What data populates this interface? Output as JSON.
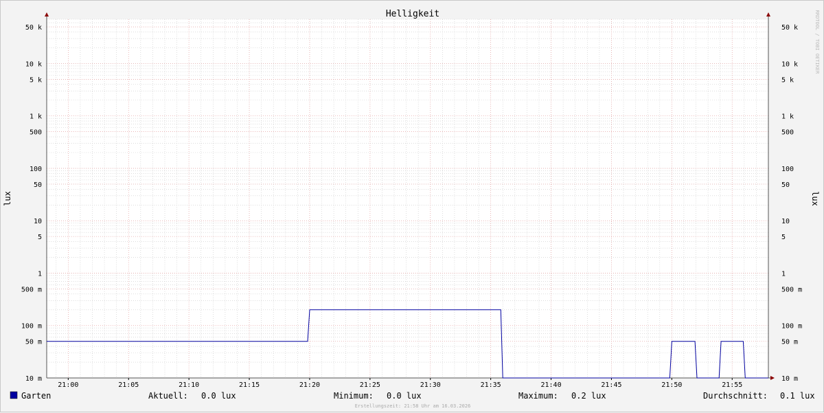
{
  "chart_data": {
    "type": "line",
    "title": "Helligkeit",
    "ylabel": "lux",
    "y_scale": "log",
    "ylim": [
      0.01,
      70000
    ],
    "y_ticks": [
      {
        "v": 50000,
        "label": "50 k"
      },
      {
        "v": 10000,
        "label": "10 k"
      },
      {
        "v": 5000,
        "label": "5 k"
      },
      {
        "v": 1000,
        "label": "1 k"
      },
      {
        "v": 500,
        "label": "500"
      },
      {
        "v": 100,
        "label": "100"
      },
      {
        "v": 50,
        "label": "50"
      },
      {
        "v": 10,
        "label": "10"
      },
      {
        "v": 5,
        "label": "5"
      },
      {
        "v": 1,
        "label": "1"
      },
      {
        "v": 0.5,
        "label": "500 m"
      },
      {
        "v": 0.1,
        "label": "100 m"
      },
      {
        "v": 0.05,
        "label": "50 m"
      },
      {
        "v": 0.01,
        "label": "10 m"
      }
    ],
    "x_ticks": [
      "21:00",
      "21:05",
      "21:10",
      "21:15",
      "21:20",
      "21:25",
      "21:30",
      "21:35",
      "21:40",
      "21:45",
      "21:50",
      "21:55"
    ],
    "series": [
      {
        "name": "Garten",
        "color": "#0000a0",
        "points": [
          {
            "x": "20:58:13",
            "y": 0.05
          },
          {
            "x": "21:19:50",
            "y": 0.05
          },
          {
            "x": "21:20:00",
            "y": 0.2
          },
          {
            "x": "21:35:50",
            "y": 0.2
          },
          {
            "x": "21:36:00",
            "y": 0.01
          },
          {
            "x": "21:49:50",
            "y": 0.01
          },
          {
            "x": "21:50:00",
            "y": 0.05
          },
          {
            "x": "21:51:55",
            "y": 0.05
          },
          {
            "x": "21:52:05",
            "y": 0.01
          },
          {
            "x": "21:53:55",
            "y": 0.01
          },
          {
            "x": "21:54:05",
            "y": 0.05
          },
          {
            "x": "21:55:55",
            "y": 0.05
          },
          {
            "x": "21:56:05",
            "y": 0.01
          },
          {
            "x": "21:58:00",
            "y": 0.01
          }
        ]
      }
    ],
    "grid": true
  },
  "watermark": "RRDTOOL / TOBI OETIKER",
  "legend": {
    "series_name": "Garten",
    "current_label": "Aktuell:",
    "current_value": "0.0 lux",
    "min_label": "Minimum:",
    "min_value": "0.0 lux",
    "max_label": "Maximum:",
    "max_value": "0.2 lux",
    "avg_label": "Durchschnitt:",
    "avg_value": "0.1 lux"
  },
  "footer": "Erstellungszeit: 21:58 Uhr am 16.03.2026",
  "colors": {
    "series": "#0000a0",
    "major_grid": "#e8a0a0",
    "minor_grid": "#c8c8c8",
    "axis_arrow": "#8b0000"
  }
}
